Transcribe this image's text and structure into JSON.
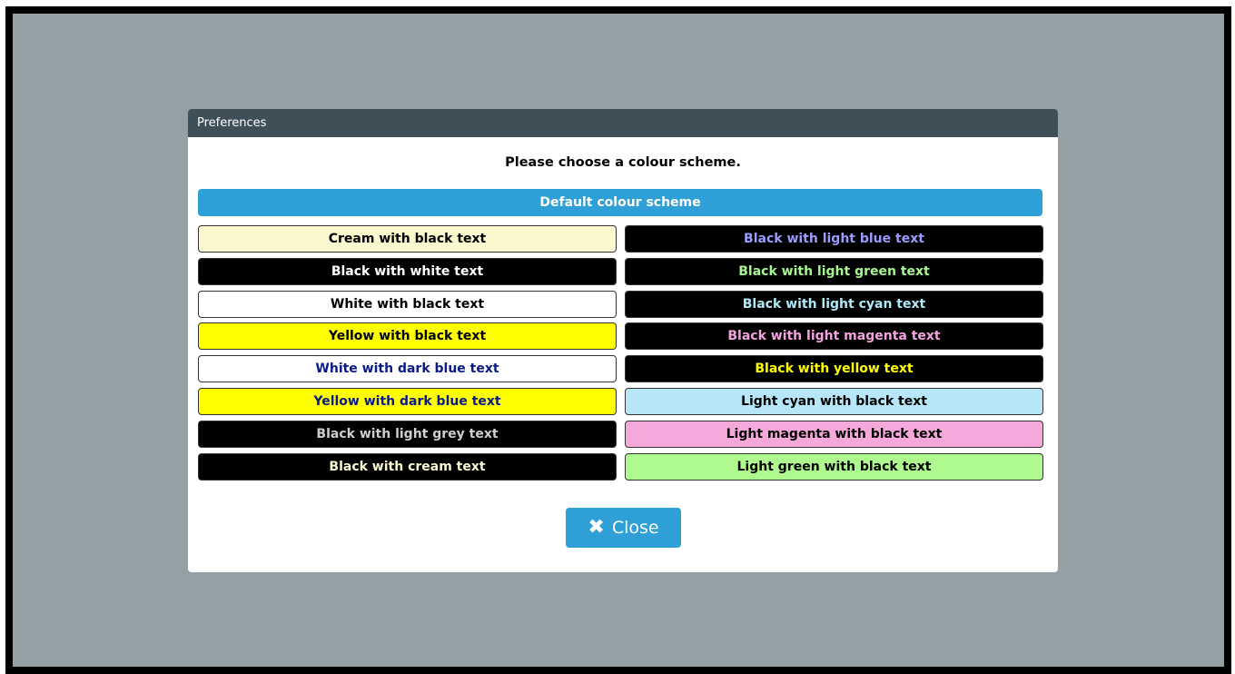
{
  "dialog": {
    "title": "Preferences",
    "prompt": "Please choose a colour scheme.",
    "default_label": "Default colour scheme",
    "close_label": "Close",
    "close_icon": "x-icon"
  },
  "colors": {
    "backdrop": "#95a0a5",
    "titlebar": "#3f4f58",
    "accent": "#2e9fd7"
  },
  "schemes_left": [
    {
      "label": "Cream with black text",
      "bg": "#fbf8cf",
      "fg": "#000000"
    },
    {
      "label": "Black with white text",
      "bg": "#000000",
      "fg": "#ffffff"
    },
    {
      "label": "White with black text",
      "bg": "#ffffff",
      "fg": "#000000"
    },
    {
      "label": "Yellow with black text",
      "bg": "#ffff00",
      "fg": "#000000"
    },
    {
      "label": "White with dark blue text",
      "bg": "#ffffff",
      "fg": "#0a1a8a"
    },
    {
      "label": "Yellow with dark blue text",
      "bg": "#ffff00",
      "fg": "#0a1a8a"
    },
    {
      "label": "Black with light grey text",
      "bg": "#000000",
      "fg": "#cfcfcf"
    },
    {
      "label": "Black with cream text",
      "bg": "#000000",
      "fg": "#fbf8cf"
    }
  ],
  "schemes_right": [
    {
      "label": "Black with light blue text",
      "bg": "#000000",
      "fg": "#9b9bff"
    },
    {
      "label": "Black with light green text",
      "bg": "#000000",
      "fg": "#a6f58f"
    },
    {
      "label": "Black with light cyan text",
      "bg": "#000000",
      "fg": "#aee9f6"
    },
    {
      "label": "Black with light magenta text",
      "bg": "#000000",
      "fg": "#f3a3df"
    },
    {
      "label": "Black with yellow text",
      "bg": "#000000",
      "fg": "#ffff00"
    },
    {
      "label": "Light cyan with black text",
      "bg": "#b6e6f8",
      "fg": "#000000"
    },
    {
      "label": "Light magenta with black text",
      "bg": "#f6a8da",
      "fg": "#000000"
    },
    {
      "label": "Light green with black text",
      "bg": "#aefa8f",
      "fg": "#000000"
    }
  ]
}
